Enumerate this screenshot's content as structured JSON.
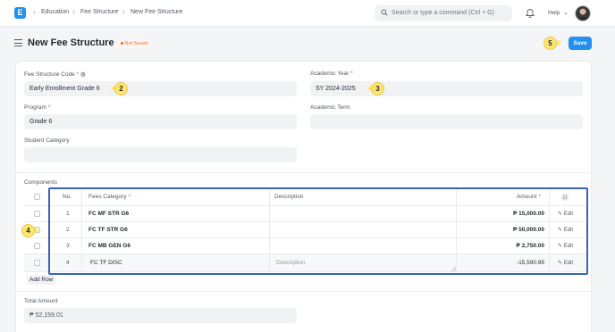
{
  "navbar": {
    "logo": "E",
    "breadcrumbs": [
      "Education",
      "Fee Structure",
      "New Fee Structure"
    ],
    "search_placeholder": "Search or type a command (Ctrl + G)",
    "help_label": "Help"
  },
  "page": {
    "title": "New Fee Structure",
    "status": "Not Saved",
    "save_label": "Save"
  },
  "form": {
    "fee_structure_code": {
      "label": "Fee Structure Code",
      "value": "Early Enrollment Grade 6"
    },
    "academic_year": {
      "label": "Academic Year",
      "value": "SY 2024-2025"
    },
    "program": {
      "label": "Program",
      "value": "Grade 6"
    },
    "academic_term": {
      "label": "Academic Term",
      "value": ""
    },
    "student_category": {
      "label": "Student Category",
      "value": ""
    },
    "components_label": "Components",
    "total_amount": {
      "label": "Total Amount",
      "value": "₱ 52,159.01"
    }
  },
  "table": {
    "headers": {
      "no": "No.",
      "fees_category": "Fees Category",
      "description": "Description",
      "amount": "Amount"
    },
    "rows": [
      {
        "no": "1",
        "fees_category": "FC MF STR G6",
        "description": "",
        "amount": "₱ 15,000.00",
        "edit": "Edit"
      },
      {
        "no": "2",
        "fees_category": "FC TF STR G6",
        "description": "",
        "amount": "₱ 50,000.00",
        "edit": "Edit"
      },
      {
        "no": "3",
        "fees_category": "FC MB GEN G6",
        "description": "",
        "amount": "₱ 2,750.00",
        "edit": "Edit"
      },
      {
        "no": "4",
        "fees_category": "FC TF DISC",
        "description_placeholder": "Description",
        "amount": "-15,590.99",
        "edit": "Edit"
      }
    ],
    "add_row_label": "Add Row"
  },
  "callouts": [
    "2",
    "3",
    "4",
    "5"
  ],
  "colors": {
    "accent": "#2490ef",
    "status": "#e2763c",
    "highlight": "#3a62b6",
    "callout": "#ffe56e"
  }
}
